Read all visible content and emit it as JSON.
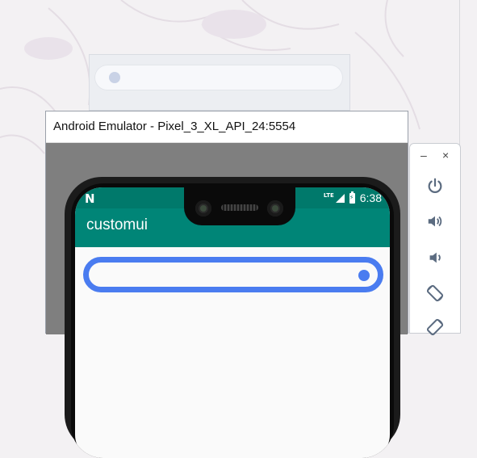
{
  "emulator": {
    "title": "Android Emulator - Pixel_3_XL_API_24:5554"
  },
  "phone": {
    "status_bar": {
      "notification_icon": "N",
      "network_label": "LTE",
      "time": "6:38"
    },
    "app_bar": {
      "title": "customui"
    },
    "switch": {
      "state": "on",
      "accent_color": "#4a7cf0"
    }
  },
  "toolbar": {
    "minimize": "–",
    "close": "×",
    "buttons": [
      {
        "name": "power-icon"
      },
      {
        "name": "volume-up-icon"
      },
      {
        "name": "volume-down-icon"
      },
      {
        "name": "rotate-left-icon"
      },
      {
        "name": "rotate-right-icon"
      }
    ]
  },
  "colors": {
    "status_bar": "#00796b",
    "app_bar": "#008577",
    "toolbar_icon": "#5b6b80"
  }
}
